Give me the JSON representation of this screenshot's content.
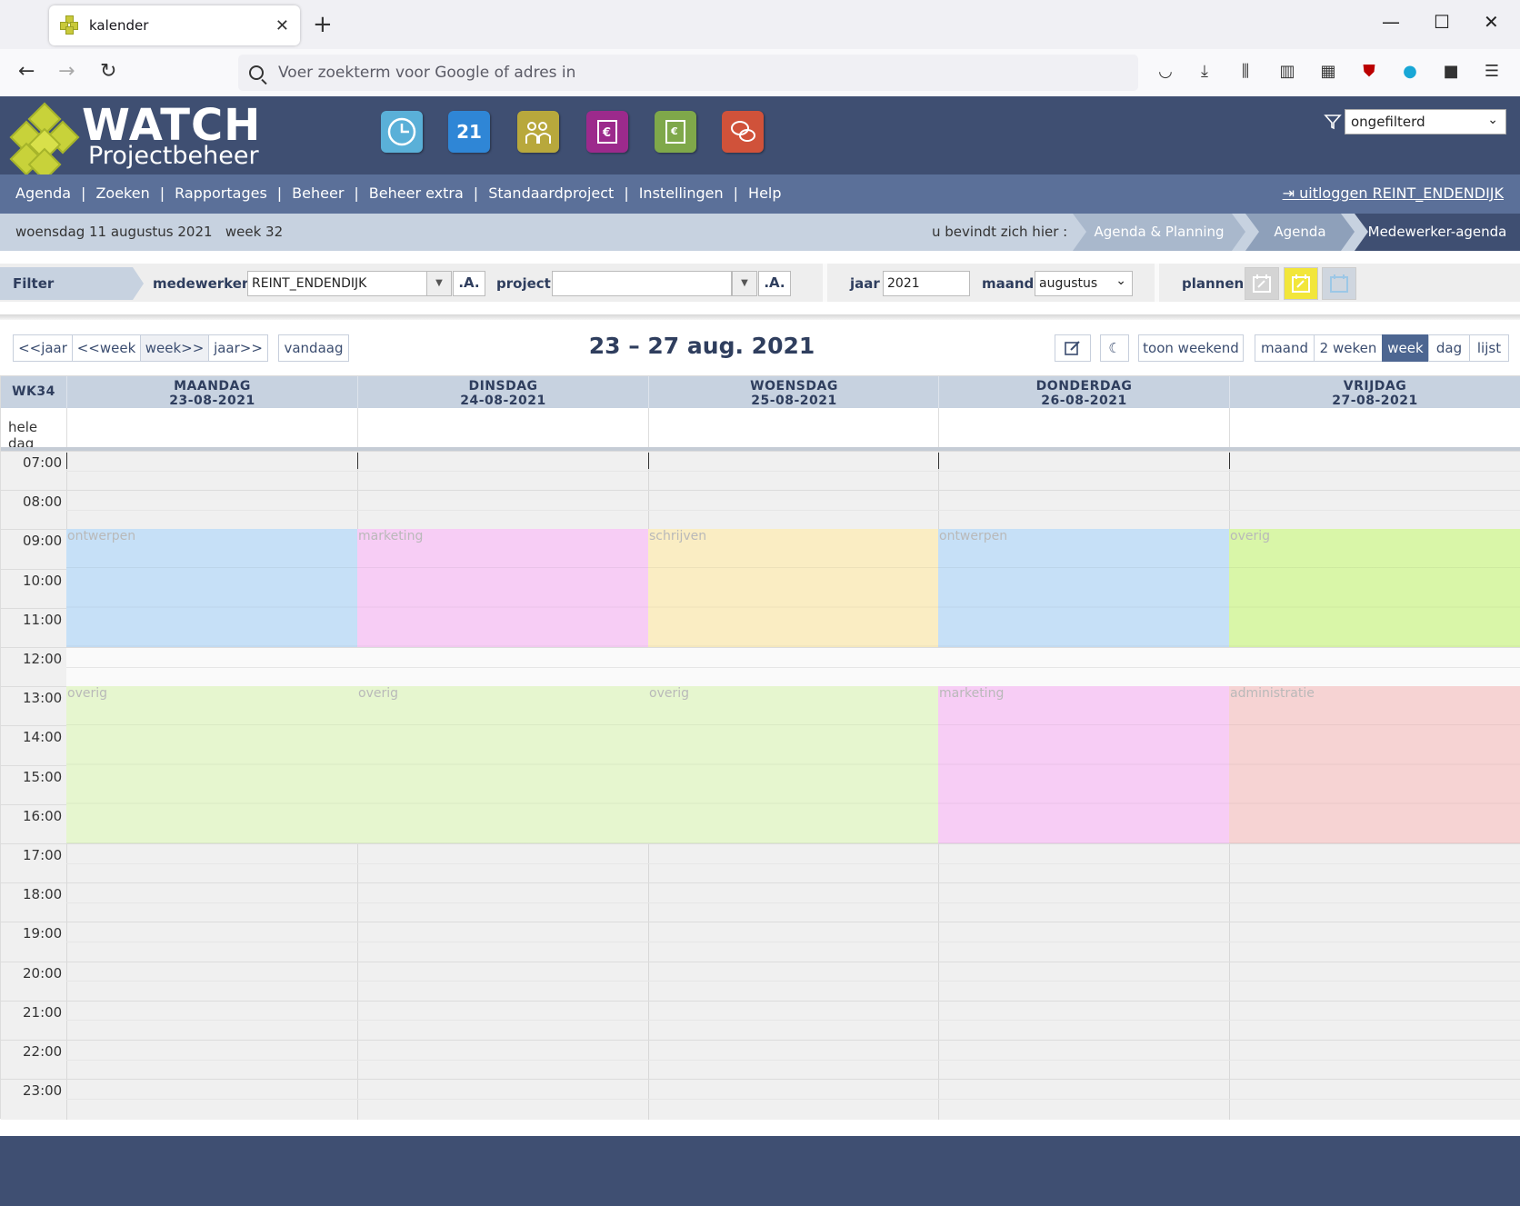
{
  "browser": {
    "tab_title": "kalender",
    "url_placeholder": "Voer zoekterm voor Google of adres in"
  },
  "app": {
    "logo_title": "WATCH",
    "logo_subtitle": "Projectbeheer",
    "filter_select": "ongefilterd",
    "calendar_module_number": "21",
    "menu": [
      "Agenda",
      "Zoeken",
      "Rapportages",
      "Beheer",
      "Beheer extra",
      "Standaardproject",
      "Instellingen",
      "Help"
    ],
    "logout": "uitloggen REINT_ENDENDIJK"
  },
  "status": {
    "date": "woensdag 11 augustus 2021",
    "week": "week 32",
    "here_label": "u bevindt zich hier :",
    "breadcrumbs": [
      "Agenda & Planning",
      "Agenda",
      "Medewerker-agenda"
    ]
  },
  "filter": {
    "label": "Filter",
    "employee_label": "medewerker",
    "employee_value": "REINT_ENDENDIJK",
    "a_label": ".A.",
    "project_label": "project",
    "project_value": "",
    "year_label": "jaar",
    "year_value": "2021",
    "month_label": "maand",
    "month_value": "augustus",
    "plan_label": "plannen"
  },
  "toolbar": {
    "nav": [
      "<<jaar",
      "<<week",
      "week>>",
      "jaar>>"
    ],
    "today": "vandaag",
    "title": "23 – 27 aug. 2021",
    "show_weekend": "toon weekend",
    "views": [
      "maand",
      "2 weken",
      "week",
      "dag",
      "lijst"
    ],
    "active_view": "week"
  },
  "calendar": {
    "week_label": "WK34",
    "allday_label": "hele dag",
    "days": [
      {
        "name": "MAANDAG",
        "date": "23-08-2021"
      },
      {
        "name": "DINSDAG",
        "date": "24-08-2021"
      },
      {
        "name": "WOENSDAG",
        "date": "25-08-2021"
      },
      {
        "name": "DONDERDAG",
        "date": "26-08-2021"
      },
      {
        "name": "VRIJDAG",
        "date": "27-08-2021"
      }
    ],
    "hours": [
      "07:00",
      "08:00",
      "09:00",
      "10:00",
      "11:00",
      "12:00",
      "13:00",
      "14:00",
      "15:00",
      "16:00",
      "17:00",
      "18:00",
      "19:00",
      "20:00",
      "21:00",
      "22:00",
      "23:00"
    ],
    "events": [
      {
        "day": 0,
        "start": 9,
        "end": 12,
        "label": "ontwerpen",
        "color": "#c6e0f7"
      },
      {
        "day": 1,
        "start": 9,
        "end": 12,
        "label": "marketing",
        "color": "#f7cdf5"
      },
      {
        "day": 2,
        "start": 9,
        "end": 12,
        "label": "schrijven",
        "color": "#faedc3"
      },
      {
        "day": 3,
        "start": 9,
        "end": 12,
        "label": "ontwerpen",
        "color": "#c6e0f7"
      },
      {
        "day": 4,
        "start": 9,
        "end": 12,
        "label": "overig",
        "color": "#d9f6a8"
      },
      {
        "day": 0,
        "start": 13,
        "end": 17,
        "label": "overig",
        "color": "#e6f6cf"
      },
      {
        "day": 1,
        "start": 13,
        "end": 17,
        "label": "overig",
        "color": "#e6f6cf"
      },
      {
        "day": 2,
        "start": 13,
        "end": 17,
        "label": "overig",
        "color": "#e6f6cf"
      },
      {
        "day": 3,
        "start": 13,
        "end": 17,
        "label": "marketing",
        "color": "#f7cdf5"
      },
      {
        "day": 4,
        "start": 13,
        "end": 17,
        "label": "administratie",
        "color": "#f6d3d3"
      }
    ]
  },
  "colors": {
    "header": "#3f4f72",
    "menu": "#5b7099",
    "crumb": "#c7d2e0",
    "active_view": "#4d6691"
  }
}
